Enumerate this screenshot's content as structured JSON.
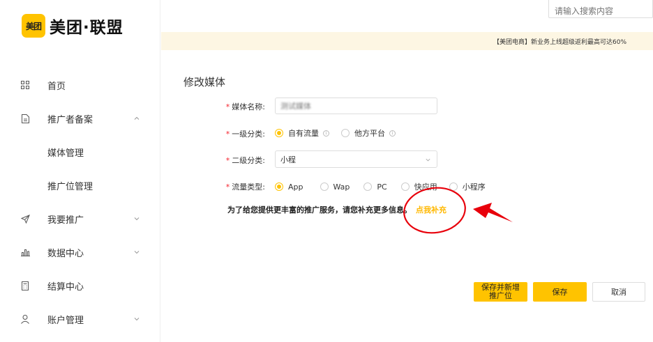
{
  "brand": {
    "mark": "美团",
    "name": "美团·联盟"
  },
  "search": {
    "placeholder": "请输入搜索内容"
  },
  "notice": {
    "text": "【美团电商】新业务上线超级返利最高可达60%"
  },
  "sidebar": {
    "items": [
      {
        "label": "首页",
        "icon": "grid-icon"
      },
      {
        "label": "推广者备案",
        "icon": "document-icon",
        "expanded": true
      },
      {
        "label": "媒体管理"
      },
      {
        "label": "推广位管理"
      },
      {
        "label": "我要推广",
        "icon": "send-icon"
      },
      {
        "label": "数据中心",
        "icon": "bar-chart-icon"
      },
      {
        "label": "结算中心",
        "icon": "calculator-icon"
      },
      {
        "label": "账户管理",
        "icon": "user-icon"
      }
    ]
  },
  "page": {
    "title": "修改媒体"
  },
  "form": {
    "media_name": {
      "label": "媒体名称:",
      "value": "测试媒体"
    },
    "category1": {
      "label": "一级分类:",
      "options": [
        "自有流量",
        "他方平台"
      ],
      "selected": "自有流量"
    },
    "category2": {
      "label": "二级分类:",
      "value": "小程"
    },
    "traffic_type": {
      "label": "流量类型:",
      "options": [
        "App",
        "Wap",
        "PC",
        "快应用",
        "小程序"
      ],
      "selected": "App"
    },
    "hint_text": "为了给您提供更丰富的推广服务，请您补充更多信息。",
    "hint_link": "点我补充"
  },
  "buttons": {
    "save_and_add": "保存并新增推广位",
    "save": "保存",
    "cancel": "取消"
  },
  "colors": {
    "accent": "#ffc300",
    "annotation": "#e8000b"
  }
}
